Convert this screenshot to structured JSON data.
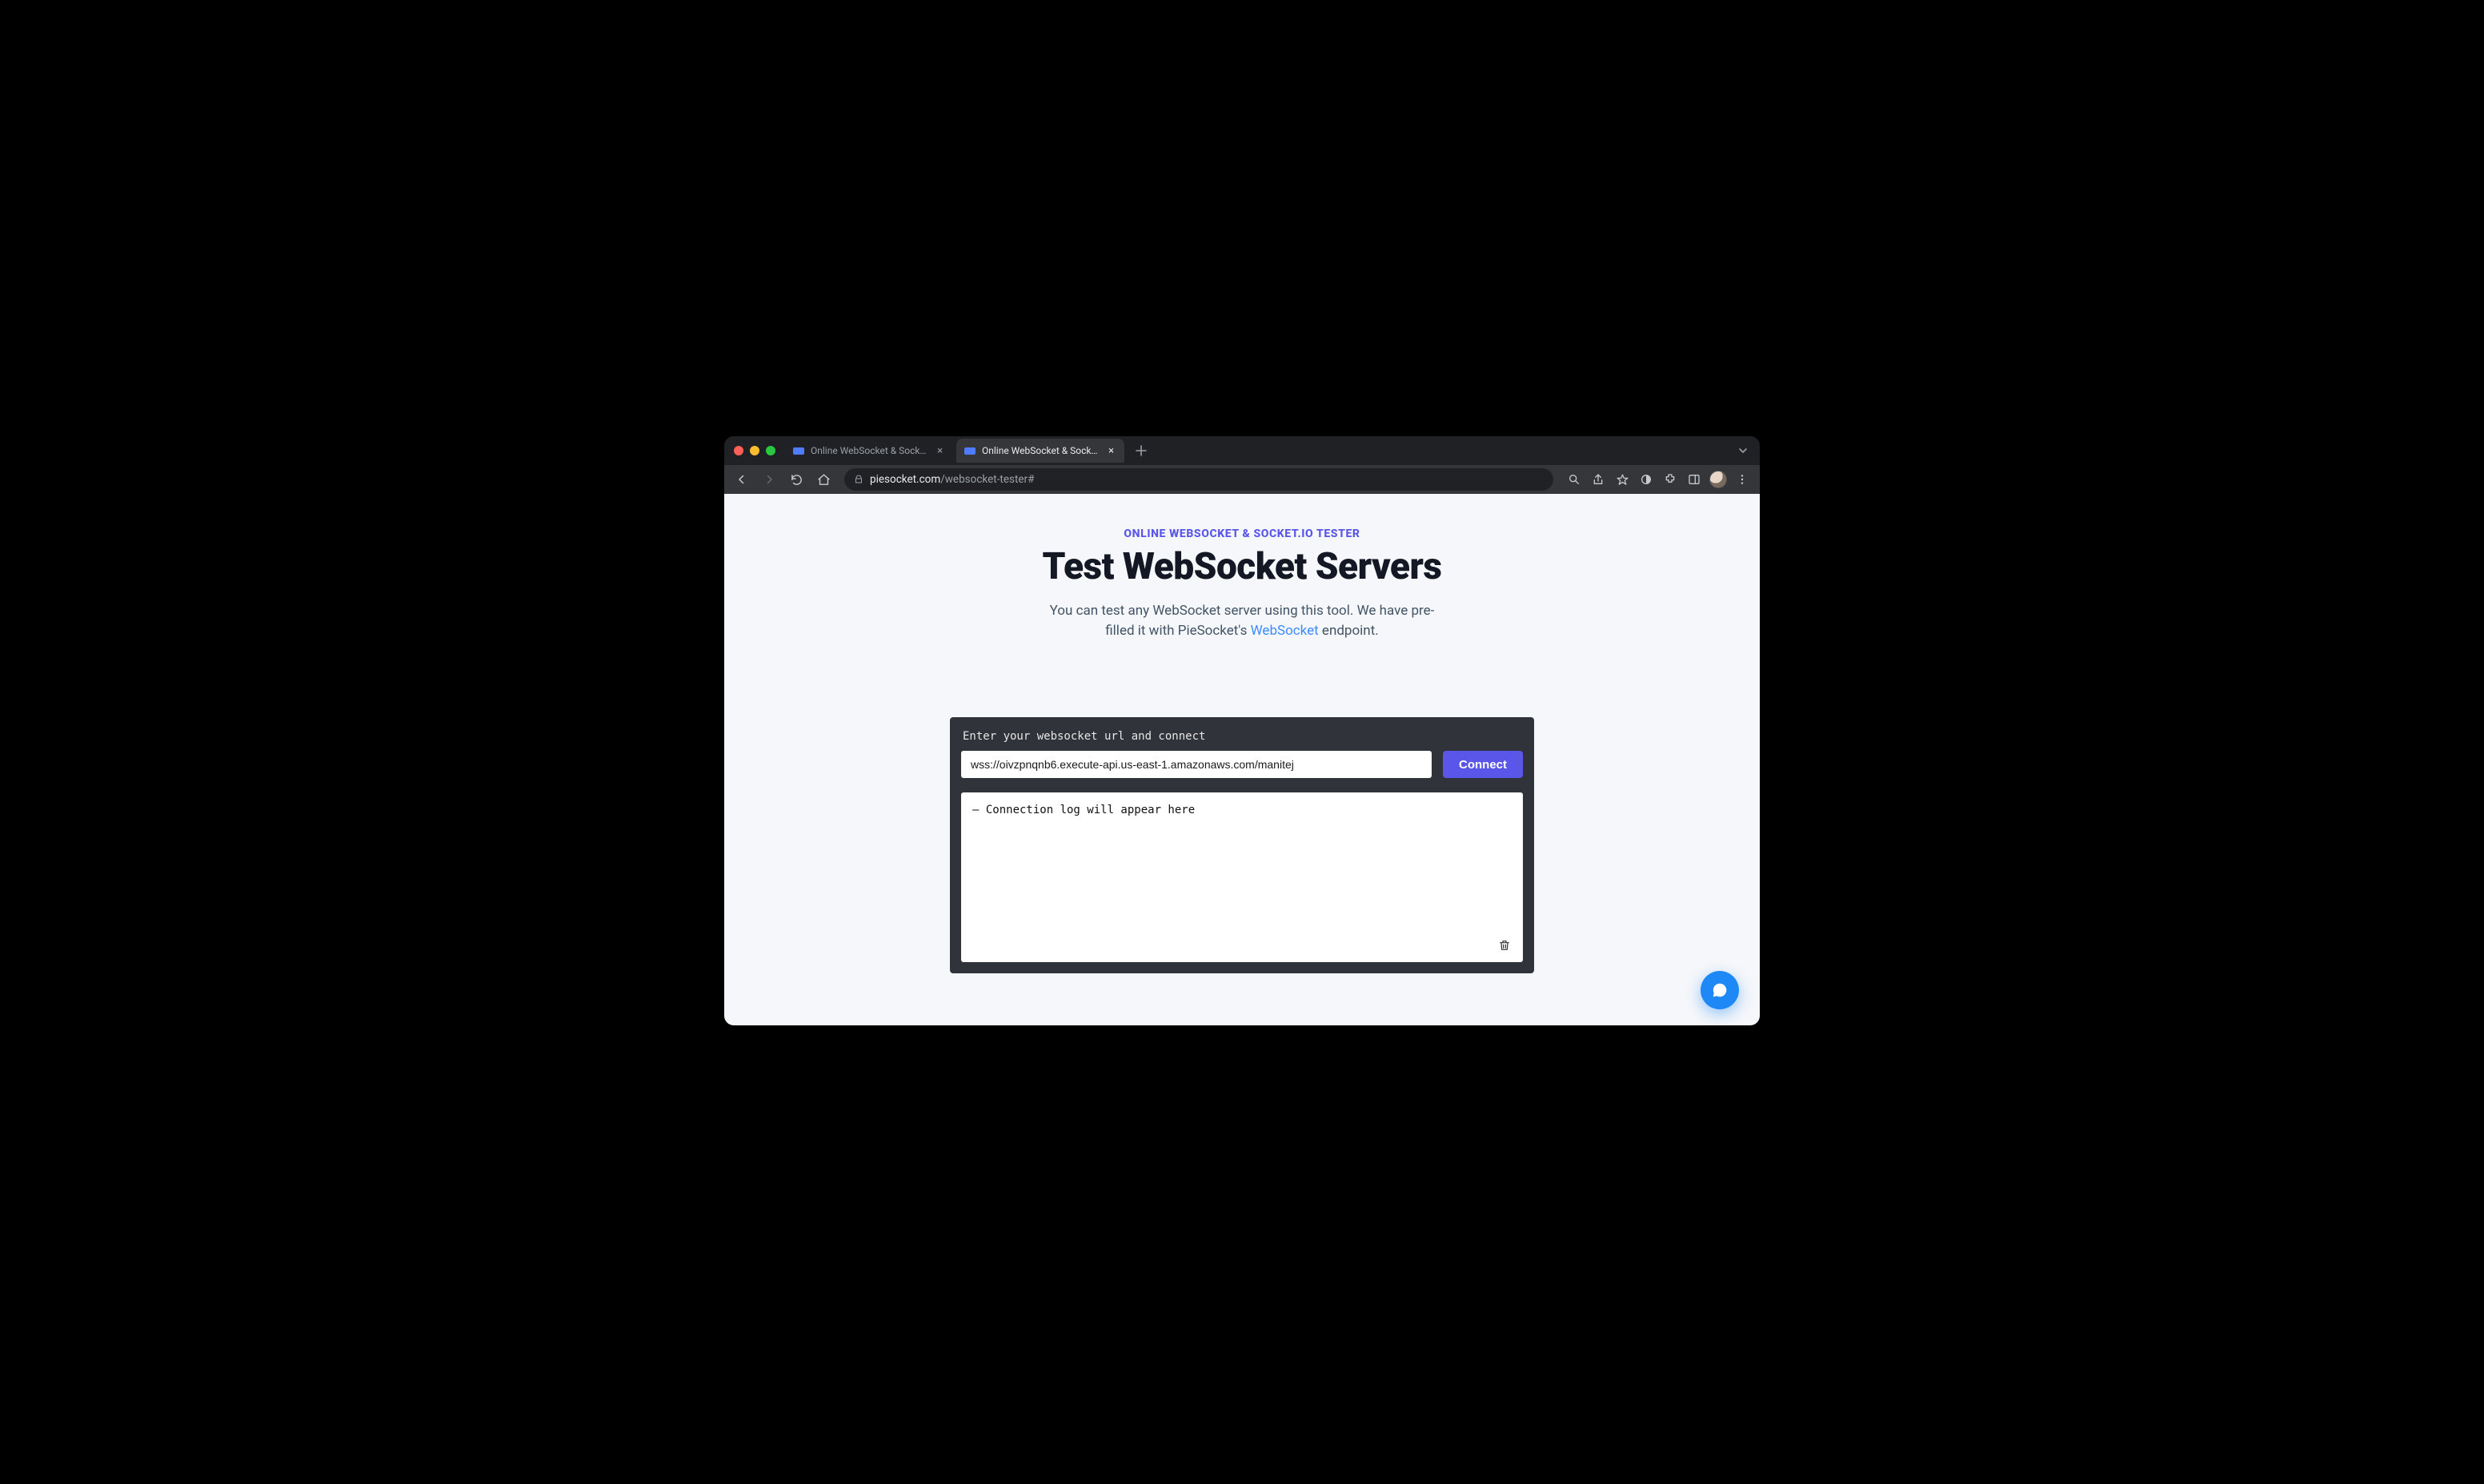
{
  "browser": {
    "tabs": [
      {
        "title": "Online WebSocket & Socket.io",
        "active": false
      },
      {
        "title": "Online WebSocket & Socket.io",
        "active": true
      }
    ],
    "url": {
      "domain": "piesocket.com",
      "path": "/websocket-tester#"
    }
  },
  "page": {
    "eyebrow": "ONLINE WEBSOCKET & SOCKET.IO TESTER",
    "headline": "Test WebSocket Servers",
    "subhead_pre": "You can test any WebSocket server using this tool. We have pre-filled it with PieSocket's ",
    "subhead_link": "WebSocket",
    "subhead_post": " endpoint."
  },
  "tester": {
    "prompt": "Enter your websocket url and connect",
    "input_value": "wss://oivzpnqnb6.execute-api.us-east-1.amazonaws.com/manitej",
    "connect_label": "Connect",
    "log_line": "Connection log will appear here"
  }
}
